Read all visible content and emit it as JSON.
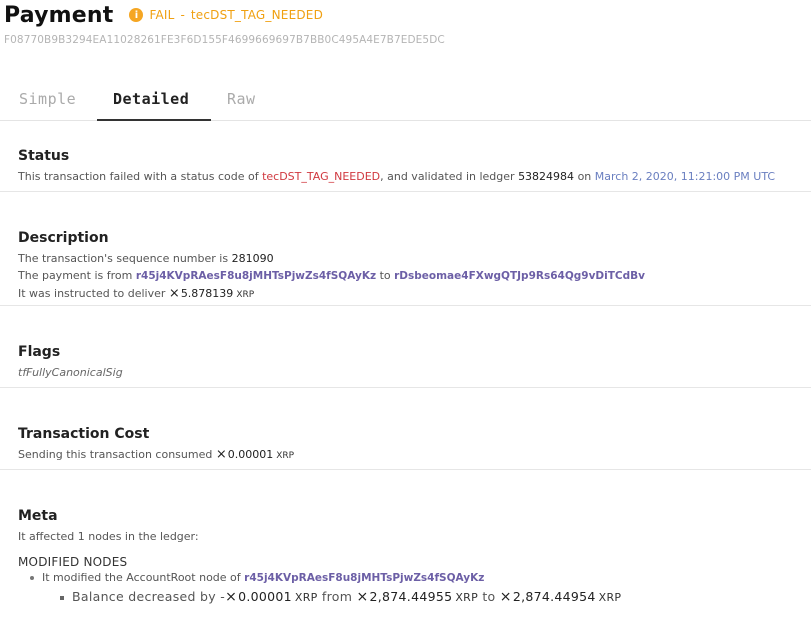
{
  "header": {
    "title": "Payment",
    "status_icon": "warning-info-icon",
    "status_result": "FAIL",
    "status_separator": "-",
    "status_code": "tecDST_TAG_NEEDED",
    "hash": "F08770B9B3294EA11028261FE3F6D155F4699669697B7BB0C495A4E7B7EDE5DC"
  },
  "tabs": [
    {
      "label": "Simple"
    },
    {
      "label": "Detailed"
    },
    {
      "label": "Raw"
    }
  ],
  "status_section": {
    "title": "Status",
    "text_1": "This transaction failed with a status code of",
    "code": "tecDST_TAG_NEEDED",
    "text_2": ", and validated in ledger",
    "ledger": "53824984",
    "text_3": "on",
    "date": "March 2, 2020, 11:21:00 PM UTC"
  },
  "description_section": {
    "title": "Description",
    "seq_text": "The transaction's sequence number is",
    "seq_value": "281090",
    "payment_from_text": "The payment is from",
    "from_address": "r45j4KVpRAesF8u8jMHTsPjwZs4fSQAyKz",
    "to_text": "to",
    "to_address": "rDsbeomae4FXwgQTJp9Rs64Qg9vDiTCdBv",
    "deliver_text": "It was instructed to deliver",
    "deliver_amount": "5.878139",
    "deliver_unit": "XRP"
  },
  "flags_section": {
    "title": "Flags",
    "flag": "tfFullyCanonicalSig"
  },
  "cost_section": {
    "title": "Transaction Cost",
    "text": "Sending this transaction consumed",
    "amount": "0.00001",
    "unit": "XRP"
  },
  "meta_section": {
    "title": "Meta",
    "affected_text": "It affected 1 nodes in the ledger:",
    "modified_heading": "MODIFIED NODES",
    "node_text": "It modified the AccountRoot node of",
    "node_address": "r45j4KVpRAesF8u8jMHTsPjwZs4fSQAyKz",
    "balance_text": "Balance decreased by",
    "balance_sign": "-",
    "decrease_amount": "0.00001",
    "decrease_unit": "XRP",
    "from_text": "from",
    "from_amount": "2,874.44955",
    "from_unit": "XRP",
    "to_text": "to",
    "to_amount": "2,874.44954",
    "to_unit": "XRP"
  },
  "xrp_symbol": "⨯",
  "colors": {
    "warning": "#f0a011",
    "error_code": "#d0383f",
    "address": "#6c5fa6",
    "date_link": "#6a7fc0"
  }
}
